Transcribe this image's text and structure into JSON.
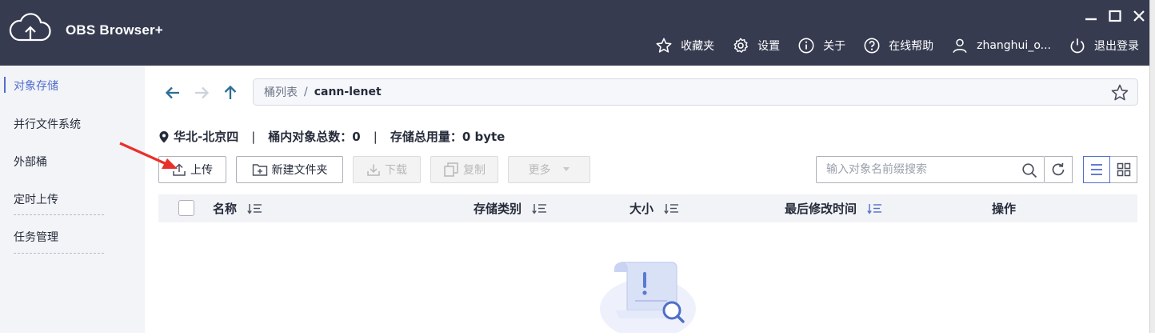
{
  "app": {
    "title": "OBS Browser+"
  },
  "topnav": {
    "favorites": "收藏夹",
    "settings": "设置",
    "about": "关于",
    "help": "在线帮助",
    "user": "zhanghui_o...",
    "logout": "退出登录"
  },
  "sidebar": {
    "items": [
      {
        "label": "对象存储"
      },
      {
        "label": "并行文件系统"
      },
      {
        "label": "外部桶"
      },
      {
        "label": "定时上传"
      },
      {
        "label": "任务管理"
      }
    ]
  },
  "breadcrumb": {
    "root": "桶列表",
    "separator": "/",
    "current": "cann-lenet"
  },
  "info": {
    "region": "华北-北京四",
    "sep": "|",
    "object_count": "桶内对象总数：0",
    "storage_used": "存储总用量：0 byte"
  },
  "toolbar": {
    "upload": "上传",
    "new_folder": "新建文件夹",
    "download": "下载",
    "copy": "复制",
    "more": "更多"
  },
  "search": {
    "placeholder": "输入对象名前缀搜索"
  },
  "table": {
    "columns": [
      "名称",
      "存储类别",
      "大小",
      "最后修改时间",
      "操作"
    ]
  },
  "colors": {
    "titlebar_bg": "#363b50",
    "sidebar_bg": "#f3f4f8",
    "accent": "#526ecc",
    "header_bg": "#f2f3f7",
    "annotation_arrow": "#e8312a"
  }
}
